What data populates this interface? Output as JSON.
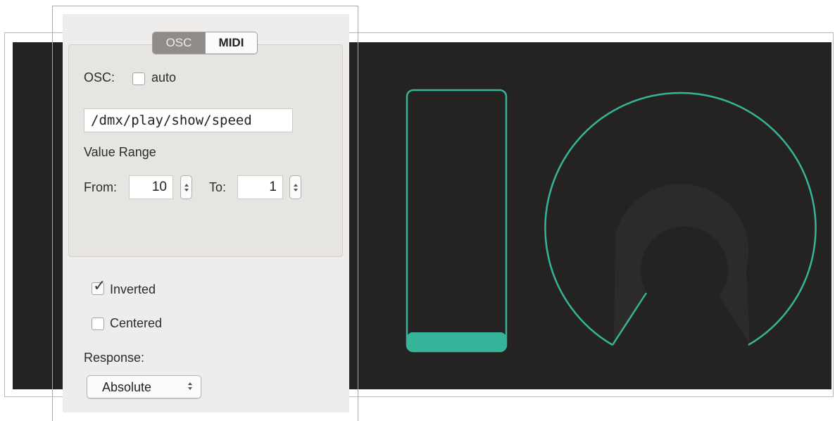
{
  "tabs": {
    "osc": "OSC",
    "midi": "MIDI",
    "active": "OSC"
  },
  "osc": {
    "label": "OSC:",
    "auto_label": "auto",
    "auto_checked": false,
    "address": "/dmx/play/show/speed"
  },
  "value_range": {
    "title": "Value Range",
    "from_label": "From:",
    "from_value": "10",
    "to_label": "To:",
    "to_value": "1"
  },
  "options": {
    "inverted_label": "Inverted",
    "inverted_checked": true,
    "centered_label": "Centered",
    "centered_checked": false
  },
  "response": {
    "label": "Response:",
    "selected": "Absolute"
  },
  "controls": {
    "fader_level": 0.06,
    "knob_level": 0.0,
    "accent_color": "#36b49a",
    "background_color": "#252322"
  }
}
